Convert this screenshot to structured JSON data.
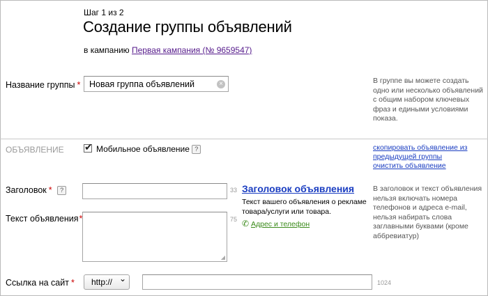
{
  "header": {
    "step": "Шаг 1 из 2",
    "title": "Создание группы объявлений",
    "campaign_prefix": "в кампанию",
    "campaign_link": "Первая кампания (№ 9659547)"
  },
  "group_name": {
    "label": "Название группы",
    "value": "Новая группа объявлений",
    "hint_lines": [
      "В группе вы можете создать",
      "одно или несколько объявлений",
      "с общим набором ключевых",
      "фраз и едиными условиями",
      "показа."
    ]
  },
  "ad_section": {
    "label": "ОБЪЯВЛЕНИЕ",
    "mobile_label": "Мобильное объявление",
    "mobile_checked": true,
    "help_symbol": "?",
    "copy_link_line1": "скопировать объявление из",
    "copy_link_line2": "предыдущей группы",
    "clear_link": "очистить объявление"
  },
  "headline": {
    "label": "Заголовок",
    "value": "",
    "counter": "33"
  },
  "ad_text": {
    "label": "Текст объявления",
    "value": "",
    "counter": "75"
  },
  "preview": {
    "title": "Заголовок объявления",
    "text_line1": "Текст вашего объявления о рекламе",
    "text_line2": "товара/услуги или товара.",
    "contact_link": "Адрес и телефон"
  },
  "ad_hint_lines": [
    "В заголовок и текст объявления",
    "нельзя включать номера",
    "телефонов и адреса e-mail,",
    "нельзя набирать слова",
    "заглавными буквами (кроме",
    "аббревиатур)"
  ],
  "site_link": {
    "label": "Ссылка на сайт",
    "protocol": "http://",
    "value": "",
    "counter": "1024"
  },
  "required_mark": "*",
  "icons": {
    "clear": "×",
    "chevron": "⌄",
    "phone": "✆",
    "check": "✔"
  }
}
